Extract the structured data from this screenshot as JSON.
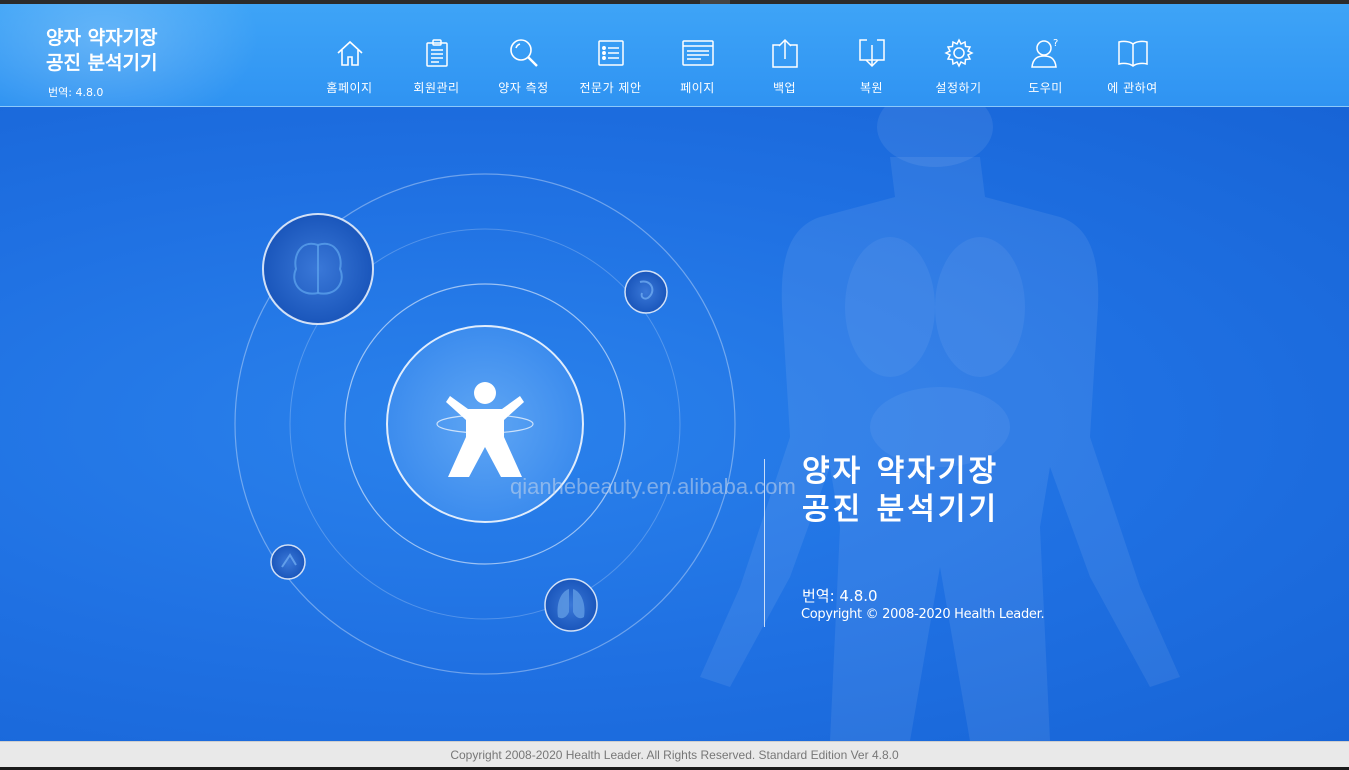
{
  "header": {
    "title_line1": "양자 약자기장",
    "title_line2": "공진 분석기기",
    "version": "번역: 4.8.0"
  },
  "nav": [
    {
      "label": "홈페이지",
      "icon": "home-icon"
    },
    {
      "label": "회원관리",
      "icon": "clipboard-icon"
    },
    {
      "label": "양자 측정",
      "icon": "search-icon"
    },
    {
      "label": "전문가 제안",
      "icon": "list-icon"
    },
    {
      "label": "페이지",
      "icon": "window-icon"
    },
    {
      "label": "백업",
      "icon": "upload-icon"
    },
    {
      "label": "복원",
      "icon": "download-icon"
    },
    {
      "label": "설정하기",
      "icon": "gear-icon"
    },
    {
      "label": "도우미",
      "icon": "help-user-icon"
    },
    {
      "label": "에 관하여",
      "icon": "book-icon"
    }
  ],
  "welcome": {
    "title_line1": "양자 약자기장",
    "title_line2": "공진 분석기기",
    "version": "번역: 4.8.0",
    "copyright": "Copyright © 2008-2020 Health Leader."
  },
  "watermark": "qianhebeauty.en.alibaba.com",
  "footer": {
    "text": "Copyright 2008-2020 Health Leader. All Rights Reserved.  Standard Edition Ver 4.8.0"
  },
  "colors": {
    "header_bg": "#3ea4f7",
    "main_bg": "#1f70e2",
    "footer_bg": "#e9e9e9"
  }
}
